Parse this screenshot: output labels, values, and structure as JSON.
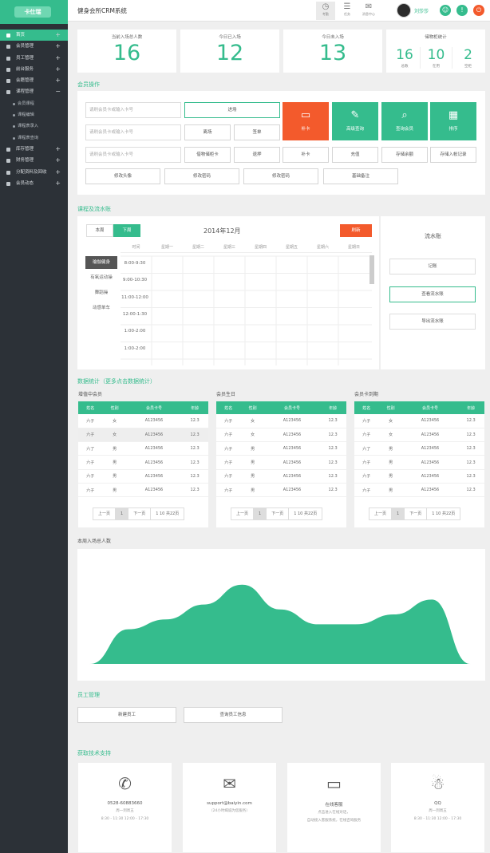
{
  "brand": {
    "logo_text": "卡仕瑞"
  },
  "header": {
    "title": "健身会所CRM系统",
    "tools": [
      {
        "label": "考勤",
        "icon": "clock-icon"
      },
      {
        "label": "任务",
        "icon": "list-icon"
      },
      {
        "label": "消息中心",
        "icon": "mail-icon"
      }
    ],
    "username": "刘莎莎"
  },
  "sidebar": {
    "items": [
      {
        "label": "首页",
        "expand": "+",
        "active": true
      },
      {
        "label": "会员管理",
        "expand": "+"
      },
      {
        "label": "员工管理",
        "expand": "+"
      },
      {
        "label": "前台服务",
        "expand": "+"
      },
      {
        "label": "会籍管理",
        "expand": "+"
      },
      {
        "label": "课程管理",
        "expand": "−"
      },
      {
        "label": "会员课程",
        "sub": true
      },
      {
        "label": "课程编辑",
        "sub": true
      },
      {
        "label": "课程表录入",
        "sub": true
      },
      {
        "label": "课程表查询",
        "sub": true
      },
      {
        "label": "库存管理",
        "expand": "+"
      },
      {
        "label": "财务管理",
        "expand": "+"
      },
      {
        "label": "分配资料及回收",
        "expand": "+"
      },
      {
        "label": "会员动态",
        "expand": "+"
      }
    ]
  },
  "stats": [
    {
      "label": "当前入场总人数",
      "value": "16"
    },
    {
      "label": "今日已入场",
      "value": "12"
    },
    {
      "label": "今日未入场",
      "value": "13"
    }
  ],
  "locker": {
    "title": "储物柜统计",
    "items": [
      {
        "value": "16",
        "label": "总数"
      },
      {
        "value": "10",
        "label": "在用"
      },
      {
        "value": "2",
        "label": "空柜"
      }
    ]
  },
  "member_ops": {
    "title": "会员操作",
    "placeholder": "请刷会员卡或输入卡号",
    "row1": [
      "进场"
    ],
    "row2": [
      "离场",
      "签单"
    ],
    "row3": [
      "借物储柜卡",
      "退押",
      "补卡",
      "充值",
      "存储余额",
      "存储入帐记录"
    ],
    "row4": [
      "修改头像",
      "修改密码",
      "修改密码",
      "基础备注"
    ],
    "tiles": [
      {
        "label": "补卡",
        "icon": "card-icon",
        "color": "#f35a2c"
      },
      {
        "label": "高级查询",
        "icon": "pen-icon",
        "color": "#35bc8d"
      },
      {
        "label": "查询会员",
        "icon": "search-icon",
        "color": "#35bc8d"
      },
      {
        "label": "排序",
        "icon": "grid-icon",
        "color": "#35bc8d"
      }
    ]
  },
  "schedule": {
    "title": "课程及流水账",
    "tabs": [
      "本周",
      "下周"
    ],
    "month": "2014年12月",
    "action": "刷新",
    "days": [
      "时间",
      "星期一",
      "星期二",
      "星期三",
      "星期四",
      "星期五",
      "星期六",
      "星期日"
    ],
    "slots": [
      "8:00-9:30",
      "9:00-10:30",
      "11:00-12:00",
      "12:00-1:30",
      "1:00-2:00",
      "1:00-2:00"
    ],
    "classes": [
      "瑜伽健身",
      "有氧运动操",
      "舞蹈操",
      "动感单车"
    ],
    "right_title": "流水账",
    "right_buttons": [
      "记账",
      "查看流水账",
      "导出流水账"
    ]
  },
  "data_stats": {
    "title": "数据统计（更多点击数据统计）",
    "tables": [
      {
        "title": "增值中会员",
        "headers": [
          "姓名",
          "性别",
          "会员卡号",
          "年龄"
        ],
        "rows": [
          [
            "六子",
            "女",
            "A123456",
            "12.3"
          ],
          [
            "六子",
            "女",
            "A123456",
            "12.3"
          ],
          [
            "六了",
            "男",
            "A123456",
            "12.3"
          ],
          [
            "六子",
            "男",
            "A123456",
            "12.3"
          ],
          [
            "六子",
            "男",
            "A123456",
            "12.3"
          ],
          [
            "六子",
            "男",
            "A123456",
            "12.3"
          ]
        ]
      },
      {
        "title": "会员生日",
        "headers": [
          "姓名",
          "性别",
          "会员卡号",
          "年龄"
        ],
        "rows": [
          [
            "六子",
            "女",
            "A123456",
            "12.3"
          ],
          [
            "六子",
            "女",
            "A123456",
            "12.3"
          ],
          [
            "六子",
            "男",
            "A123456",
            "12.3"
          ],
          [
            "六子",
            "男",
            "A123456",
            "12.3"
          ],
          [
            "六子",
            "男",
            "A123456",
            "12.3"
          ],
          [
            "六子",
            "男",
            "A123456",
            "12.3"
          ]
        ]
      },
      {
        "title": "会员卡到期",
        "headers": [
          "姓名",
          "性别",
          "会员卡号",
          "年龄"
        ],
        "rows": [
          [
            "六子",
            "女",
            "A123456",
            "12.3"
          ],
          [
            "六子",
            "女",
            "A123456",
            "12.3"
          ],
          [
            "六了",
            "男",
            "A123456",
            "12.3"
          ],
          [
            "六子",
            "男",
            "A123456",
            "12.3"
          ],
          [
            "六子",
            "男",
            "A123456",
            "12.3"
          ],
          [
            "六子",
            "男",
            "A123456",
            "12.3"
          ]
        ]
      }
    ],
    "pager": [
      "上一页",
      "1",
      "下一页",
      "1 10 共22页"
    ]
  },
  "chart_data": {
    "type": "area",
    "title": "本周入场总人数",
    "x": [
      0,
      1,
      2,
      3,
      4,
      5,
      6,
      7,
      8,
      9,
      10
    ],
    "values": [
      0,
      35,
      45,
      60,
      80,
      55,
      40,
      40,
      50,
      65,
      0
    ],
    "ylim": [
      0,
      100
    ],
    "color": "#35bc8d"
  },
  "staff": {
    "title": "员工管理",
    "buttons": [
      "新建员工",
      "查询员工信息"
    ]
  },
  "support": {
    "title": "获取技术支持",
    "cards": [
      {
        "icon": "phone-icon",
        "line1": "0528-60883660",
        "line2": "周一到周五",
        "line3": "8:30 - 11:30  12:00 - 17:30"
      },
      {
        "icon": "mail-icon",
        "line1": "support@baiyin.com",
        "line2": "（24小时竭诚为您服务）"
      },
      {
        "icon": "chat-icon",
        "line1": "在线客服",
        "line2": "点击进入在线对话，",
        "line3": "自动接入客服系统，在线咨询服务"
      },
      {
        "icon": "qq-icon",
        "line1": "QQ",
        "line2": "周一到周五",
        "line3": "8:30 - 11:30  12:00 - 17:30"
      }
    ]
  }
}
